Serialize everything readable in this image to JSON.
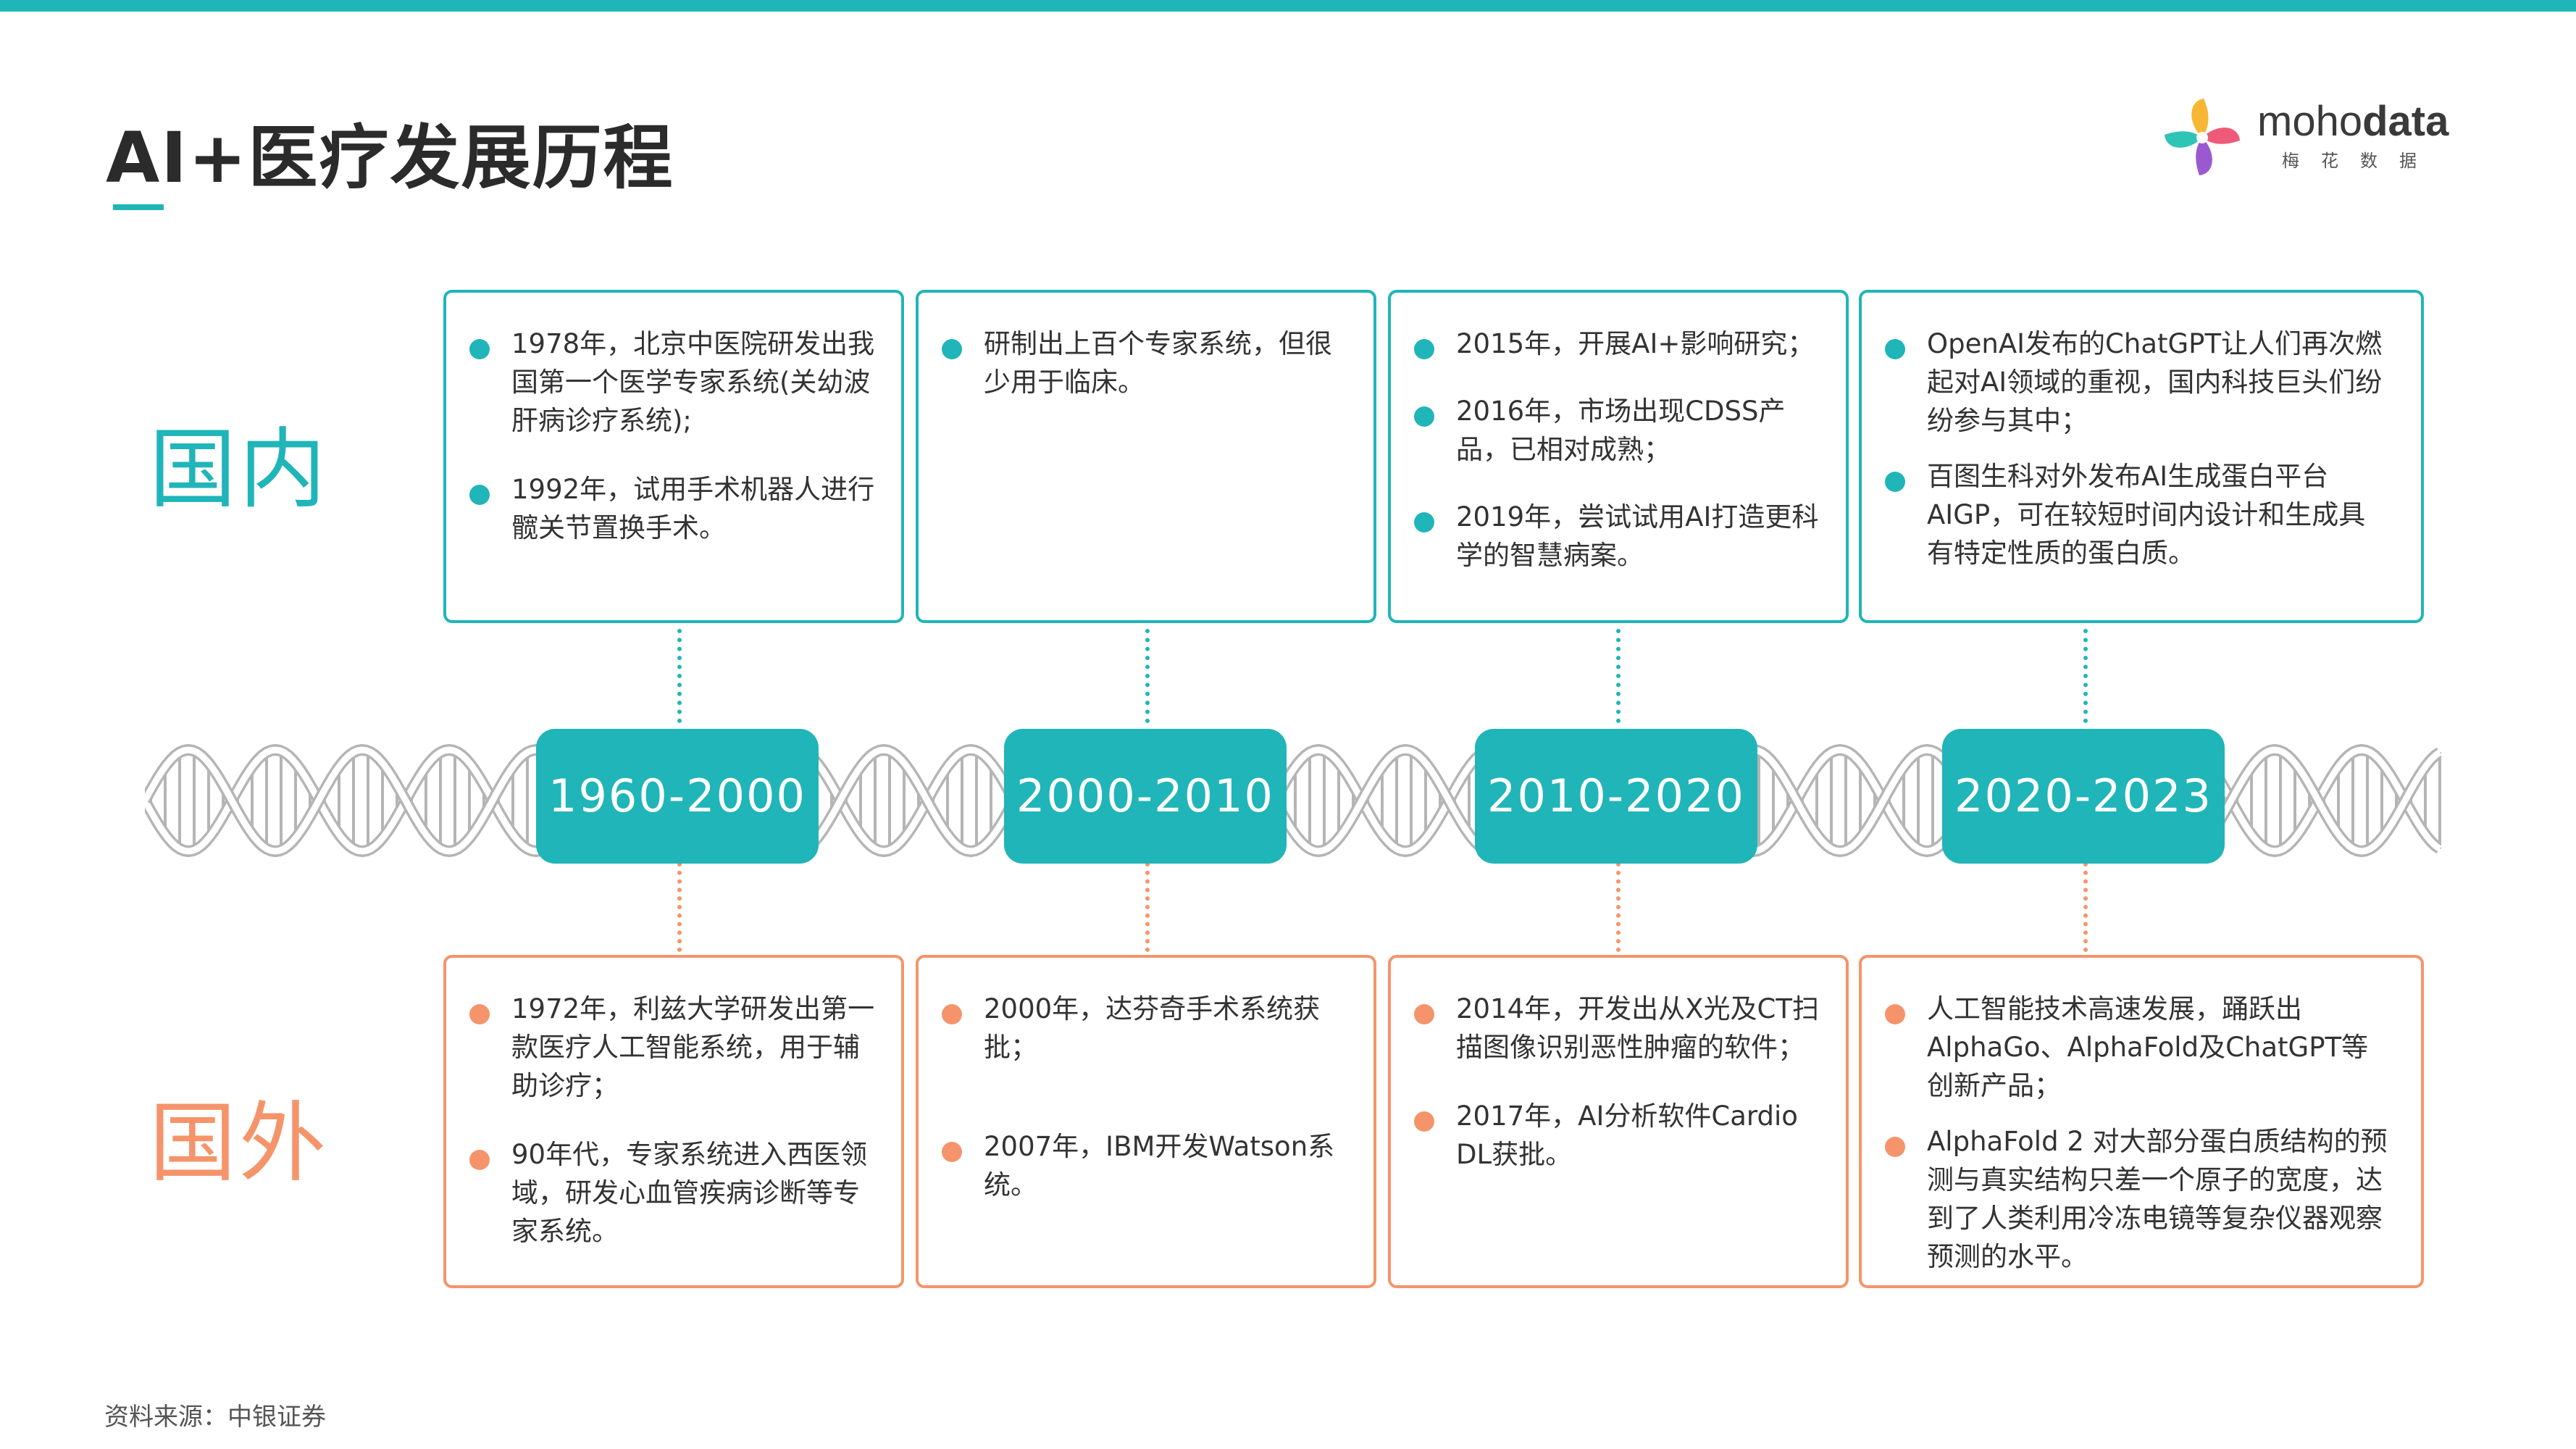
{
  "title": "AI+医疗发展历程",
  "logo": {
    "brand_light": "moho",
    "brand_bold": "data",
    "subtitle": "梅花数据"
  },
  "labels": {
    "domestic": "国内",
    "foreign": "国外"
  },
  "periods": [
    {
      "era": "1960-2000",
      "domestic": [
        "1978年，北京中医院研发出我国第一个医学专家系统(关幼波肝病诊疗系统);",
        "1992年，试用手术机器人进行髋关节置换手术。"
      ],
      "foreign": [
        "1972年，利兹大学研发出第一款医疗人工智能系统，用于辅助诊疗；",
        "90年代，专家系统进入西医领域，研发心血管疾病诊断等专家系统。"
      ]
    },
    {
      "era": "2000-2010",
      "domestic": [
        "研制出上百个专家系统，但很少用于临床。"
      ],
      "foreign": [
        "2000年，达芬奇手术系统获批；",
        "2007年，IBM开发Watson系统。"
      ]
    },
    {
      "era": "2010-2020",
      "domestic": [
        "2015年，开展AI+影响研究；",
        "2016年，市场出现CDSS产品，已相对成熟；",
        "2019年，尝试试用AI打造更科学的智慧病案。"
      ],
      "foreign": [
        "2014年，开发出从X光及CT扫描图像识别恶性肿瘤的软件；",
        "2017年，AI分析软件Cardio DL获批。"
      ]
    },
    {
      "era": "2020-2023",
      "domestic": [
        "OpenAI发布的ChatGPT让人们再次燃起对AI领域的重视，国内科技巨头们纷纷参与其中；",
        "百图生科对外发布AI生成蛋白平台AIGP，可在较短时间内设计和生成具有特定性质的蛋白质。"
      ],
      "foreign": [
        "人工智能技术高速发展，踊跃出AlphaGo、AlphaFold及ChatGPT等创新产品；",
        "AlphaFold 2 对大部分蛋白质结构的预测与真实结构只差一个原子的宽度，达到了人类利用冷冻电镜等复杂仪器观察预测的水平。"
      ]
    }
  ],
  "source": "资料来源：中银证券",
  "colors": {
    "teal": "#20b5b8",
    "orange": "#f5946b",
    "dna": "#b5b5b5"
  }
}
